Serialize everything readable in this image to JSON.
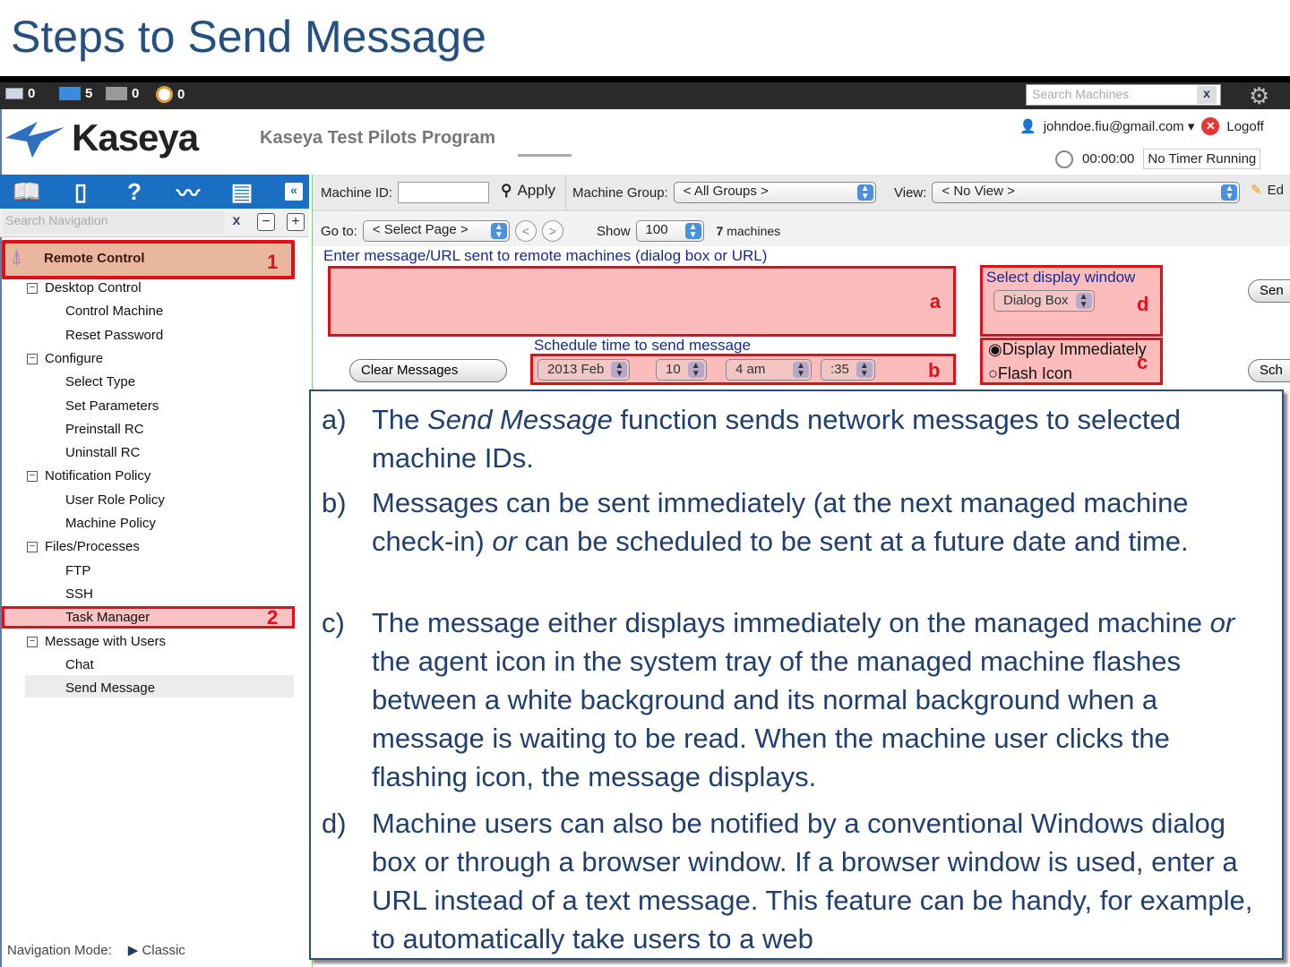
{
  "slide_title": "Steps to Send Message",
  "topbar": {
    "mail_count": "0",
    "online_count": "5",
    "offline_count": "0",
    "alarm_count": "0",
    "search_placeholder": "Search Machines",
    "search_clear": "x"
  },
  "header": {
    "logo": "Kaseya",
    "program": "Kaseya Test Pilots Program",
    "user": "johndoe.fiu@gmail.com ▾",
    "logoff": "Logoff",
    "timer_value": "00:00:00",
    "timer_status": "No Timer Running"
  },
  "nav": {
    "search_placeholder": "Search Navigation",
    "clear": "x",
    "collapse_all": "−",
    "expand_all": "+",
    "collapse_panel": "«",
    "module": "Remote Control",
    "module_marker": "1",
    "tree": [
      {
        "label": "Desktop Control",
        "level": 1
      },
      {
        "label": "Control Machine",
        "level": 2
      },
      {
        "label": "Reset Password",
        "level": 2
      },
      {
        "label": "Configure",
        "level": 1
      },
      {
        "label": "Select Type",
        "level": 2
      },
      {
        "label": "Set Parameters",
        "level": 2
      },
      {
        "label": "Preinstall RC",
        "level": 2
      },
      {
        "label": "Uninstall RC",
        "level": 2
      },
      {
        "label": "Notification Policy",
        "level": 1
      },
      {
        "label": "User Role Policy",
        "level": 2
      },
      {
        "label": "Machine Policy",
        "level": 2
      },
      {
        "label": "Files/Processes",
        "level": 1
      },
      {
        "label": "FTP",
        "level": 2
      },
      {
        "label": "SSH",
        "level": 2
      },
      {
        "label": "Task Manager",
        "level": 2
      },
      {
        "label": "Message with Users",
        "level": 1
      },
      {
        "label": "Chat",
        "level": 2
      },
      {
        "label": "Send Message",
        "level": 2
      }
    ],
    "task_marker": "2",
    "mode_label": "Navigation Mode:",
    "mode_value": "Classic"
  },
  "filter": {
    "machine_id_label": "Machine ID:",
    "machine_id_value": "",
    "apply": "Apply",
    "group_label": "Machine Group:",
    "group_value": "< All Groups >",
    "view_label": "View:",
    "view_value": "< No View >",
    "edit": "Ed",
    "goto_label": "Go to:",
    "goto_value": "< Select Page >",
    "prev": "<",
    "next": ">",
    "show_label": "Show",
    "show_value": "100",
    "count_num": "7",
    "count_label": "machines"
  },
  "form": {
    "message_label": "Enter message/URL sent to remote machines (dialog box or URL)",
    "message_value": "",
    "marker_a": "a",
    "display_label": "Select display window",
    "display_value": "Dialog Box",
    "marker_d": "d",
    "schedule_label": "Schedule time to send message",
    "year_month": "2013 Feb",
    "day": "10",
    "hour": "4 am",
    "minute": ":35",
    "marker_b": "b",
    "radio_immediate": "Display Immediately",
    "radio_flash": "Flash Icon",
    "marker_c": "c",
    "immediate_checked": true,
    "clear_button": "Clear Messages",
    "send_button": "Sen",
    "schedule_button": "Sch"
  },
  "callout": [
    {
      "letter": "a)",
      "pre": "The ",
      "em": "Send Message",
      "post": " function sends network messages to selected machine IDs."
    },
    {
      "letter": "b)",
      "pre": "Messages can be sent immediately (at the next managed machine check-in) ",
      "em": "or",
      "post": " can be scheduled to be sent at a future date and time."
    },
    {
      "letter": "c)",
      "pre": "The message either displays immediately on the managed machine ",
      "em": "or",
      "post": " the agent icon in the system tray of the managed machine flashes between a white background and its normal background when a message is waiting to be read. When the machine user clicks the flashing icon, the message displays."
    },
    {
      "letter": "d)",
      "pre": "Machine users can also be notified by a conventional Windows dialog box or through a browser window. If a browser window is used, enter a URL instead of a text message. This feature can be handy, for example, to automatically take users to a web",
      "em": "",
      "post": ""
    }
  ]
}
